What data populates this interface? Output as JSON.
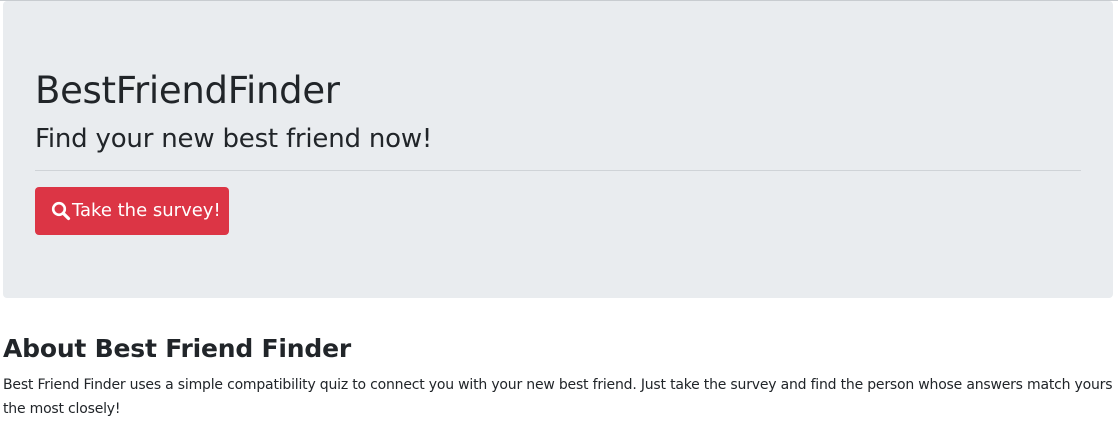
{
  "colors": {
    "jumbotron_bg": "#e9ecef",
    "primary_button": "#dc3545",
    "text": "#212529"
  },
  "jumbotron": {
    "title": "BestFriendFinder",
    "subtitle": "Find your new best friend now!",
    "button": {
      "icon": "search-icon",
      "label": "Take the survey!"
    }
  },
  "about": {
    "heading": "About Best Friend Finder",
    "text": "Best Friend Finder uses a simple compatibility quiz to connect you with your new best friend. Just take the survey and find the person whose answers match yours the most closely!"
  }
}
